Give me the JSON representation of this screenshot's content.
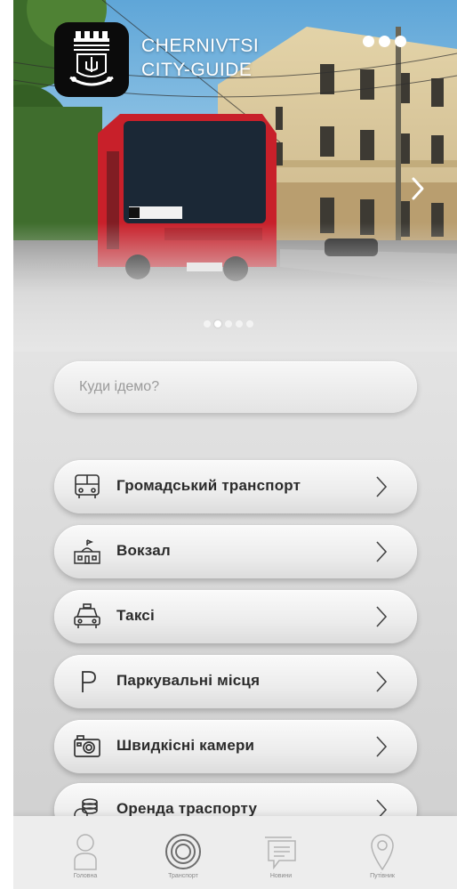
{
  "header": {
    "brand_line1": "CHERNIVTSI",
    "brand_line2": "CITY-GUIDE",
    "logo_icon": "city-crest-icon",
    "more_icon": "more-dots-icon",
    "next_icon": "chevron-right-icon",
    "slides_count": 5,
    "active_slide": 2
  },
  "search": {
    "placeholder": "Куди ідемо?",
    "value": ""
  },
  "menu": [
    {
      "label": "Громадський транспорт",
      "icon": "bus-icon"
    },
    {
      "label": "Вокзал",
      "icon": "station-icon"
    },
    {
      "label": "Таксі",
      "icon": "taxi-icon"
    },
    {
      "label": "Паркувальні місця",
      "icon": "parking-icon"
    },
    {
      "label": "Швидкісні камери",
      "icon": "camera-icon"
    },
    {
      "label": "Оренда траспорту",
      "icon": "rental-icon"
    }
  ],
  "bottom_nav": [
    {
      "label": "Головна",
      "icon": "person-icon",
      "active": false
    },
    {
      "label": "Транспорт",
      "icon": "target-icon",
      "active": true
    },
    {
      "label": "Новини",
      "icon": "chat-icon",
      "active": false
    },
    {
      "label": "Путівник",
      "icon": "location-pin-icon",
      "active": false
    }
  ],
  "colors": {
    "bus_red": "#c8202a",
    "building": "#d9c9a0",
    "sky": "#8ec3e8",
    "nav_bg": "#ededed",
    "text_dark": "#2b2b2b"
  }
}
